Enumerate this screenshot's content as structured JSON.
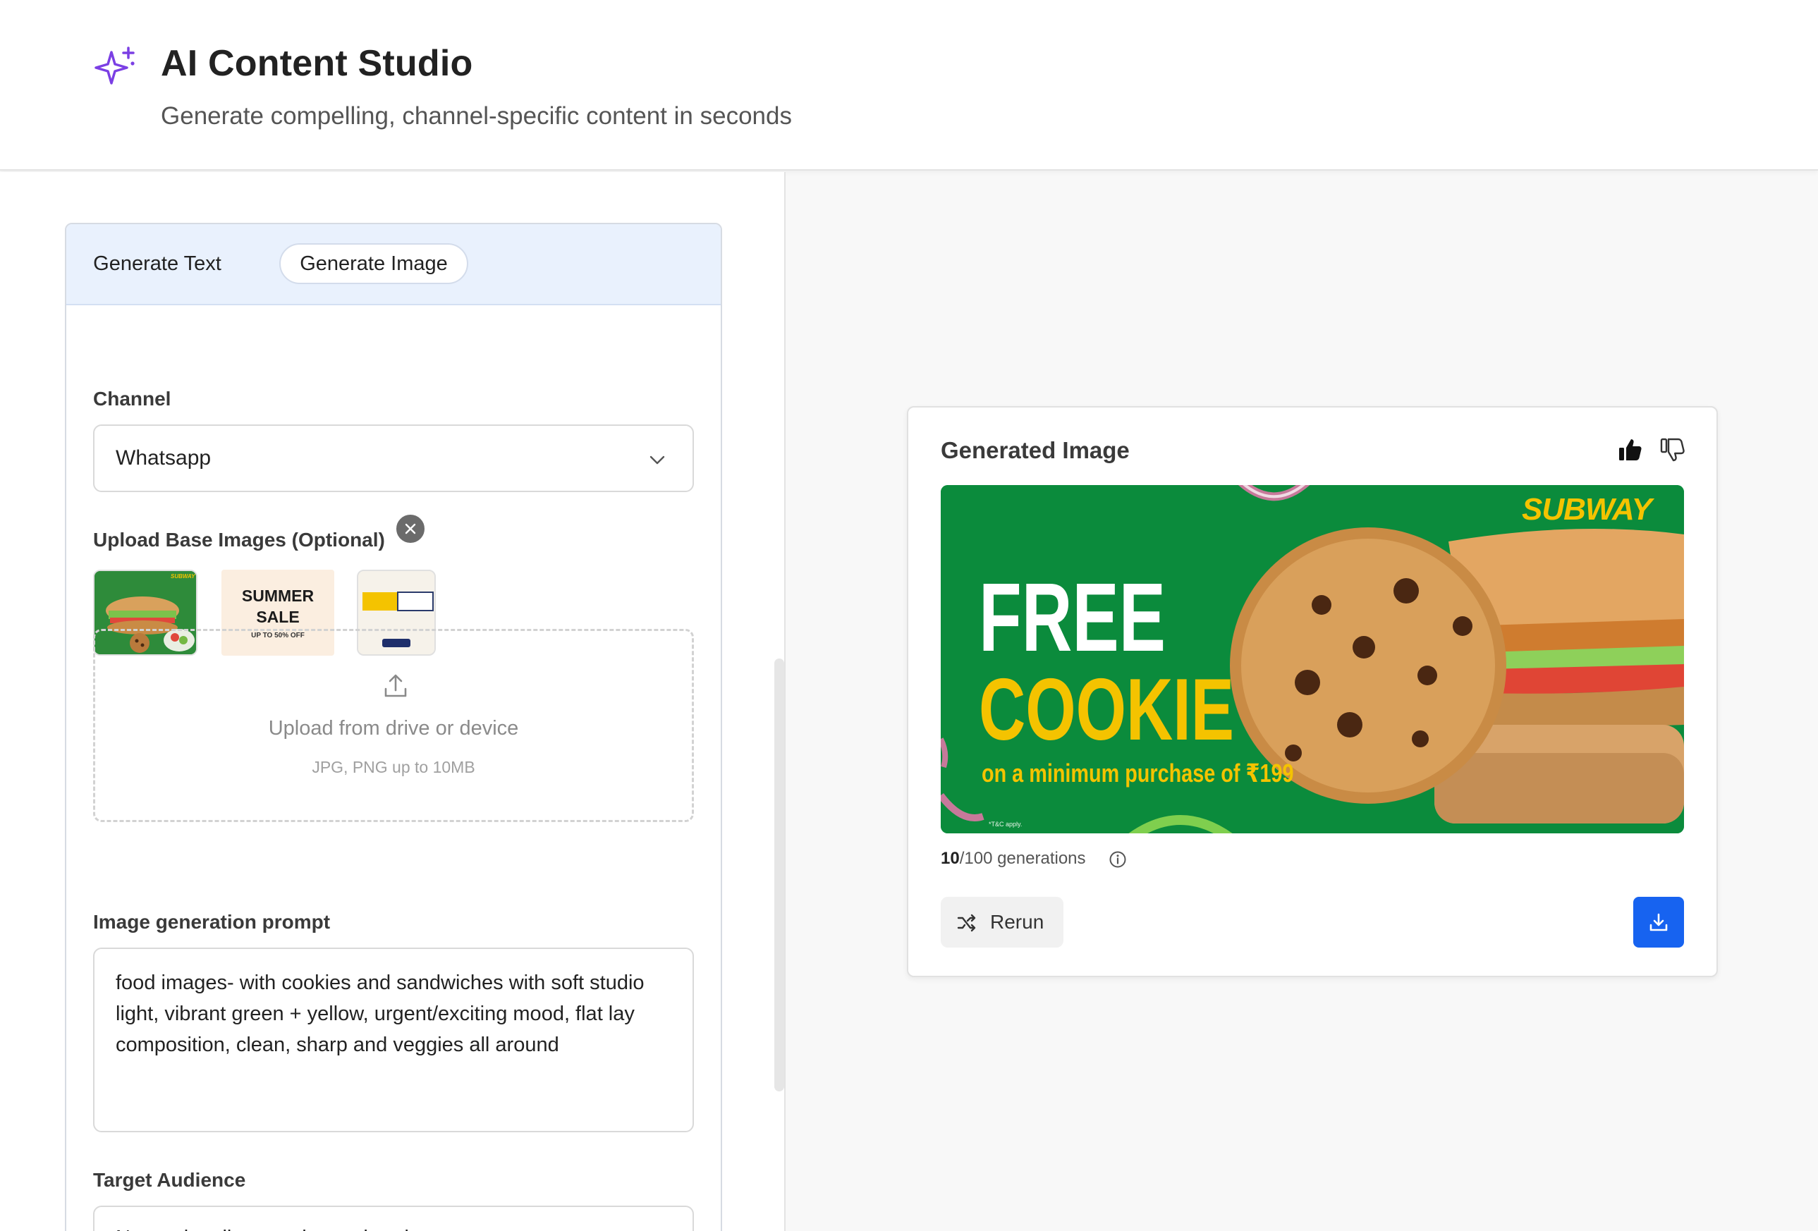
{
  "header": {
    "title": "AI Content Studio",
    "subtitle": "Generate compelling, channel-specific content in seconds",
    "icon": "sparkle-icon",
    "accent_color": "#7b3fe4"
  },
  "tabs": [
    {
      "label": "Generate Text",
      "active": false
    },
    {
      "label": "Generate Image",
      "active": true
    }
  ],
  "form": {
    "channel_label": "Channel",
    "channel_value": "Whatsapp",
    "upload_label": "Upload Base Images (Optional)",
    "base_images": [
      {
        "name": "subway-sandwich-thumbnail"
      },
      {
        "name": "summer-sale-thumbnail",
        "title": "SUMMER SALE",
        "subtitle": "UP TO 50% OFF"
      },
      {
        "name": "special-offer-thumbnail"
      }
    ],
    "dropzone_title": "Upload from drive or device",
    "dropzone_hint": "JPG, PNG up to 10MB",
    "prompt_label": "Image generation prompt",
    "prompt_value": "food images- with cookies and sandwiches with soft studio light, vibrant green + yellow, urgent/exciting mood, flat lay composition, clean, sharp and veggies all around",
    "audience_label": "Target Audience",
    "audience_value": "New subscribers and cart abandoners"
  },
  "result": {
    "title": "Generated Image",
    "image": {
      "brand": "SUBWAY",
      "headline_1": "FREE",
      "headline_2": "COOKIE",
      "offer": "on a minimum purchase of ₹199",
      "disclaimer": "*T&C apply.",
      "background_color": "#0b8b3c",
      "accent_color": "#f4c300"
    },
    "usage_count": "10",
    "usage_rest": "/100 generations",
    "rerun_label": "Rerun",
    "download_color": "#1763f0"
  }
}
